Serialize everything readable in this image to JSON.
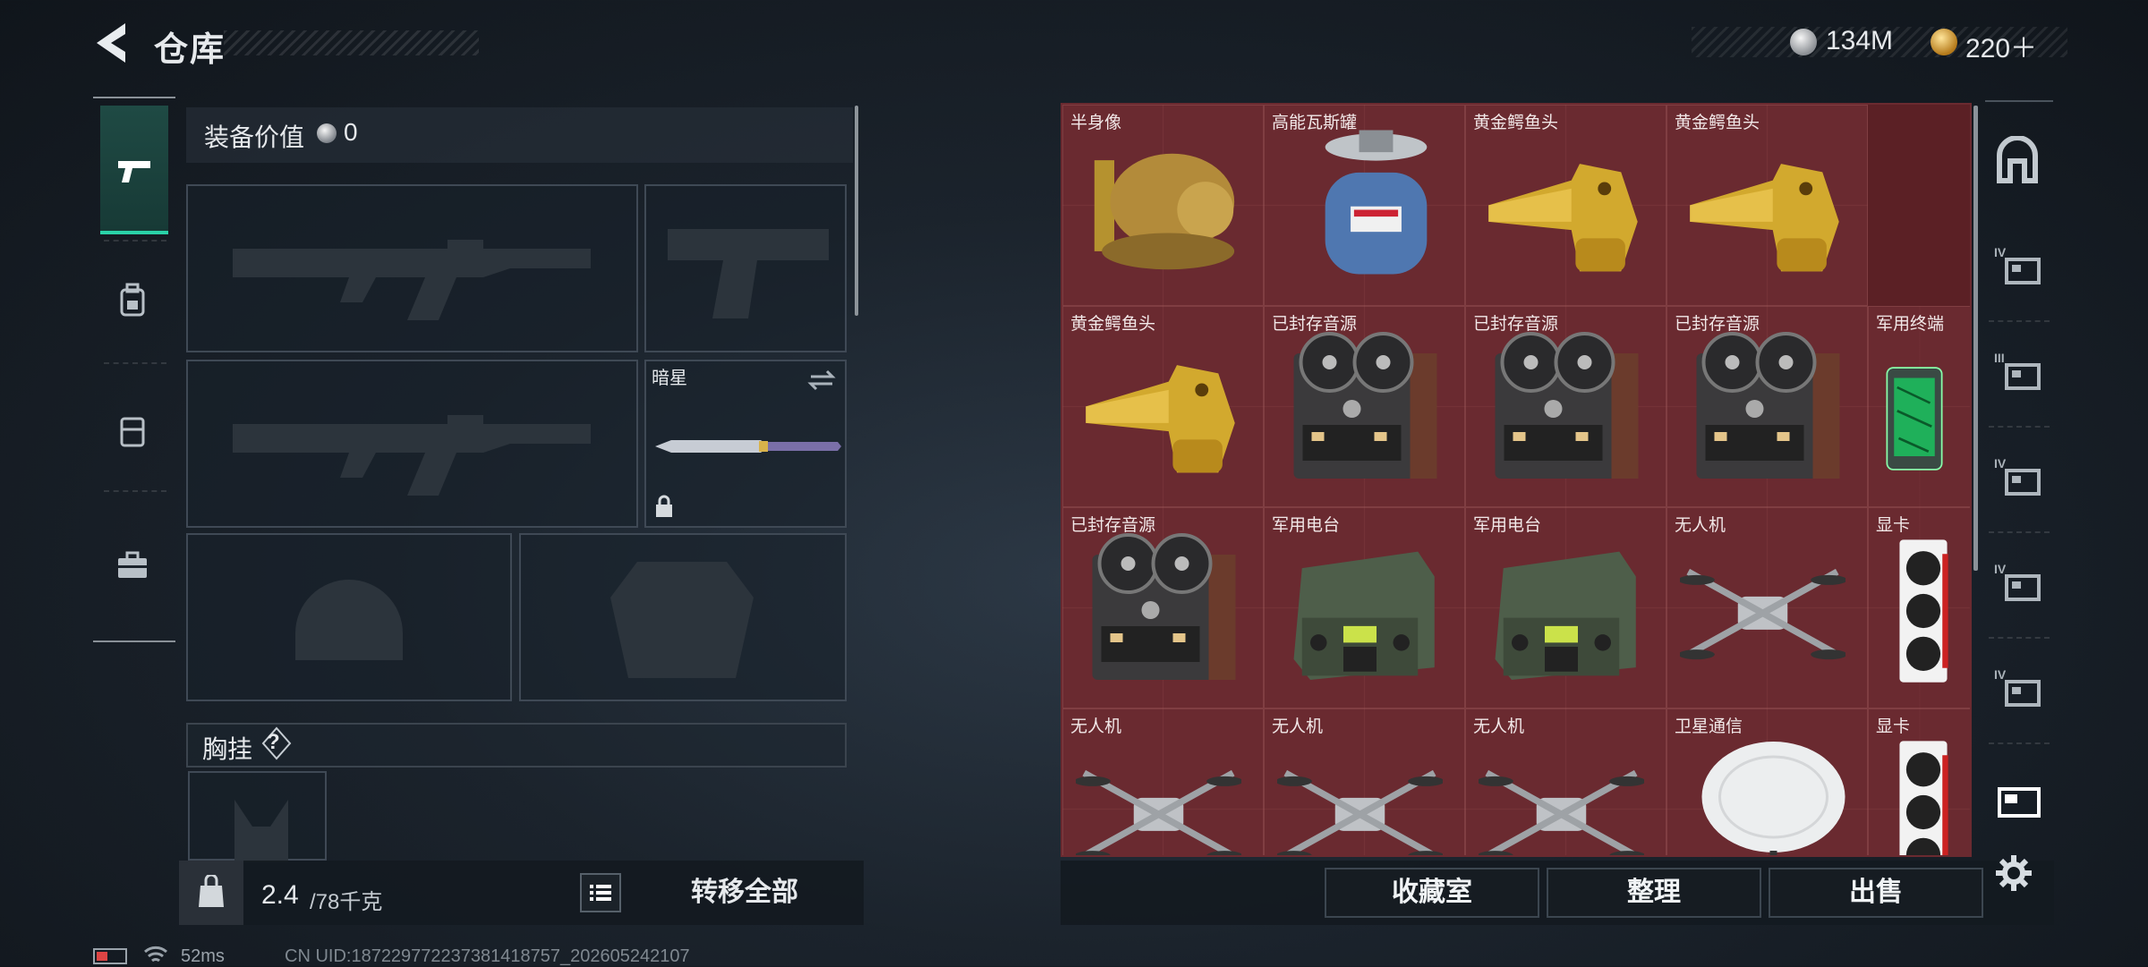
{
  "header": {
    "title": "仓库",
    "currency_silver": "134M",
    "currency_gold": "220＋"
  },
  "equipment": {
    "label": "装备价值",
    "value": "0",
    "knife_slot_name": "暗星",
    "chest_label": "胸挂",
    "chest_help": "?"
  },
  "bottom_left": {
    "weight_current": "2.4",
    "weight_rest": "/78千克",
    "transfer_all": "转移全部"
  },
  "stash": {
    "rows": [
      [
        {
          "label": "半身像",
          "icon": "bust-icon"
        },
        {
          "label": "高能瓦斯罐",
          "icon": "gas-canister-icon"
        },
        {
          "label": "黄金鳄鱼头",
          "icon": "gold-crocodile-head-icon"
        },
        {
          "label": "黄金鳄鱼头",
          "icon": "gold-crocodile-head-icon"
        }
      ],
      [
        {
          "label": "黄金鳄鱼头",
          "icon": "gold-crocodile-head-icon"
        },
        {
          "label": "已封存音源",
          "icon": "reel-recorder-icon"
        },
        {
          "label": "已封存音源",
          "icon": "reel-recorder-icon"
        },
        {
          "label": "已封存音源",
          "icon": "reel-recorder-icon"
        },
        {
          "label": "军用终端",
          "icon": "military-terminal-icon"
        }
      ],
      [
        {
          "label": "已封存音源",
          "icon": "reel-recorder-icon"
        },
        {
          "label": "军用电台",
          "icon": "military-radio-icon"
        },
        {
          "label": "军用电台",
          "icon": "military-radio-icon"
        },
        {
          "label": "无人机",
          "icon": "drone-icon"
        },
        {
          "label": "显卡",
          "icon": "graphics-card-icon"
        }
      ],
      [
        {
          "label": "无人机",
          "icon": "drone-icon"
        },
        {
          "label": "无人机",
          "icon": "drone-icon"
        },
        {
          "label": "无人机",
          "icon": "drone-icon"
        },
        {
          "label": "卫星通信",
          "icon": "satellite-dish-icon"
        },
        {
          "label": "显卡",
          "icon": "graphics-card-icon"
        }
      ]
    ]
  },
  "buttons": {
    "collection": "收藏室",
    "organize": "整理",
    "sell": "出售"
  },
  "right_column": {
    "tabs": [
      "IV",
      "III",
      "IV",
      "IV",
      "IV"
    ]
  },
  "status": {
    "ping": "52ms",
    "uid": "CN UID:18722977223738141875​7_202605242107"
  },
  "colors": {
    "accent": "#2ad2a8",
    "stash_bg": "#6a2a30"
  }
}
